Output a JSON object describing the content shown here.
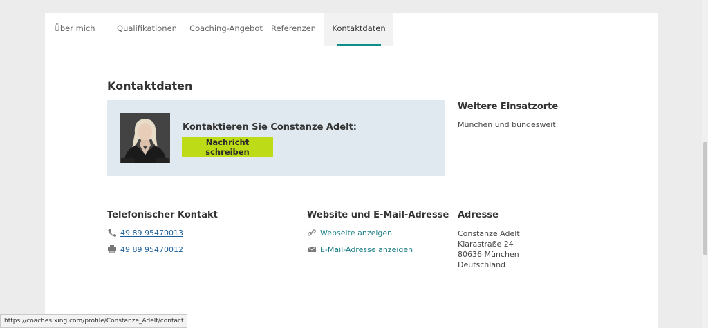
{
  "tabs": [
    {
      "label": "Über mich",
      "active": false
    },
    {
      "label": "Qualifikationen",
      "active": false
    },
    {
      "label": "Coaching-Angebot",
      "active": false
    },
    {
      "label": "Referenzen",
      "active": false
    },
    {
      "label": "Kontaktdaten",
      "active": true
    }
  ],
  "page_title": "Kontaktdaten",
  "contact_box": {
    "heading": "Kontaktieren Sie Constanze Adelt:",
    "button_label": "Nachricht schreiben",
    "button_color": "#bedb17",
    "background": "#dfe9ef"
  },
  "further_locations": {
    "title": "Weitere Einsatzorte",
    "text": "München und bundesweit"
  },
  "phone": {
    "title": "Telefonischer Kontakt",
    "entries": [
      {
        "icon": "phone-icon",
        "number": "49 89 95470013"
      },
      {
        "icon": "fax-icon",
        "number": "49 89 95470012"
      }
    ]
  },
  "web_email": {
    "title": "Website und E-Mail-Adresse",
    "website_link": "Webseite anzeigen",
    "email_link": "E-Mail-Adresse anzeigen",
    "link_color": "#1d7f86"
  },
  "address": {
    "title": "Adresse",
    "lines": [
      "Constanze Adelt",
      "Klarastraße 24",
      "80636 München",
      "Deutschland"
    ]
  },
  "status_bar": {
    "url": "https://coaches.xing.com/profile/Constanze_Adelt/contact"
  },
  "accent_color": "#0f8e8a"
}
